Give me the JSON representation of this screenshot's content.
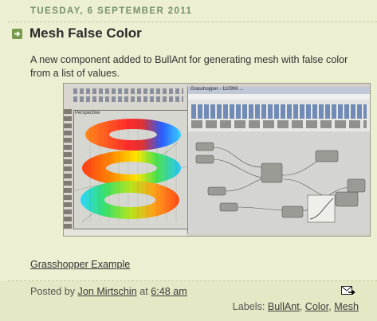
{
  "date_header": "Tuesday, 6 September 2011",
  "post": {
    "title": "Mesh False Color",
    "body": "A new component added to BullAnt for generating mesh with false color from a list of values.",
    "link_text": "Grasshopper Example"
  },
  "screenshot": {
    "rhino_viewport_label": "Perspective",
    "gh_title": "Grasshopper - 110906 ..."
  },
  "footer": {
    "posted_by_prefix": "Posted by",
    "author": "Jon Mirtschin",
    "at_word": "at",
    "time": "6:48 am",
    "labels_prefix": "Labels:",
    "labels": [
      "BullAnt",
      "Color",
      "Mesh"
    ]
  },
  "icons": {
    "post_marker": "arrow-right-icon",
    "email": "email-post-icon"
  },
  "colors": {
    "background": "#ecefd1",
    "date_header": "#76916e",
    "footer_bar": "#e4e8c4",
    "title": "#2a2a2a"
  }
}
